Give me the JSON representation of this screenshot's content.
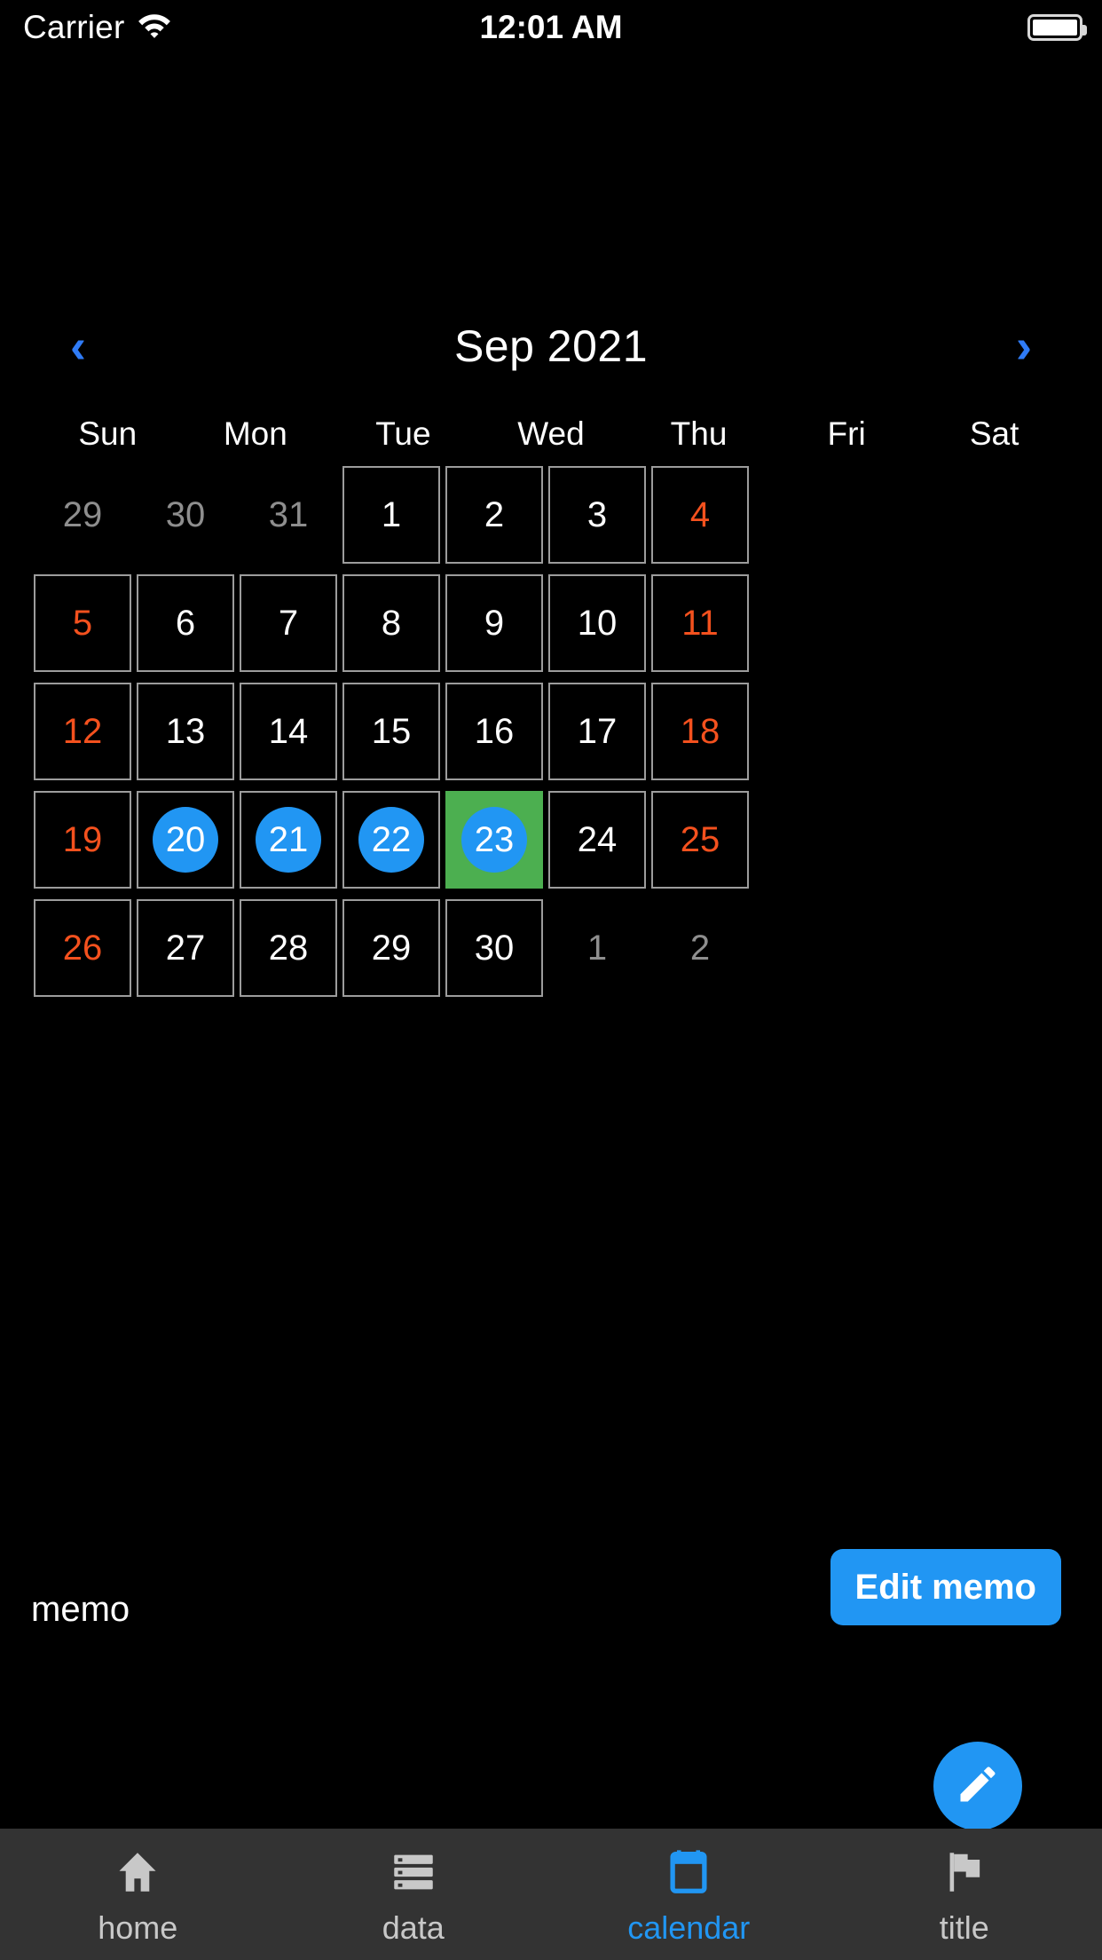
{
  "status_bar": {
    "carrier": "Carrier",
    "wifi_icon": "wifi-icon",
    "time": "12:01 AM",
    "battery_icon": "battery-full-icon"
  },
  "calendar": {
    "month_title": "Sep 2021",
    "prev_label": "‹",
    "next_label": "›",
    "weekdays": [
      "Sun",
      "Mon",
      "Tue",
      "Wed",
      "Thu",
      "Fri",
      "Sat"
    ],
    "weeks": [
      [
        {
          "day": "29",
          "in_month": false,
          "marked": false,
          "today": false
        },
        {
          "day": "30",
          "in_month": false,
          "marked": false,
          "today": false
        },
        {
          "day": "31",
          "in_month": false,
          "marked": false,
          "today": false
        },
        {
          "day": "1",
          "in_month": true,
          "marked": false,
          "today": false
        },
        {
          "day": "2",
          "in_month": true,
          "marked": false,
          "today": false
        },
        {
          "day": "3",
          "in_month": true,
          "marked": false,
          "today": false
        },
        {
          "day": "4",
          "in_month": true,
          "marked": false,
          "today": false
        }
      ],
      [
        {
          "day": "5",
          "in_month": true,
          "marked": false,
          "today": false
        },
        {
          "day": "6",
          "in_month": true,
          "marked": false,
          "today": false
        },
        {
          "day": "7",
          "in_month": true,
          "marked": false,
          "today": false
        },
        {
          "day": "8",
          "in_month": true,
          "marked": false,
          "today": false
        },
        {
          "day": "9",
          "in_month": true,
          "marked": false,
          "today": false
        },
        {
          "day": "10",
          "in_month": true,
          "marked": false,
          "today": false
        },
        {
          "day": "11",
          "in_month": true,
          "marked": false,
          "today": false
        }
      ],
      [
        {
          "day": "12",
          "in_month": true,
          "marked": false,
          "today": false
        },
        {
          "day": "13",
          "in_month": true,
          "marked": false,
          "today": false
        },
        {
          "day": "14",
          "in_month": true,
          "marked": false,
          "today": false
        },
        {
          "day": "15",
          "in_month": true,
          "marked": false,
          "today": false
        },
        {
          "day": "16",
          "in_month": true,
          "marked": false,
          "today": false
        },
        {
          "day": "17",
          "in_month": true,
          "marked": false,
          "today": false
        },
        {
          "day": "18",
          "in_month": true,
          "marked": false,
          "today": false
        }
      ],
      [
        {
          "day": "19",
          "in_month": true,
          "marked": false,
          "today": false
        },
        {
          "day": "20",
          "in_month": true,
          "marked": true,
          "today": false
        },
        {
          "day": "21",
          "in_month": true,
          "marked": true,
          "today": false
        },
        {
          "day": "22",
          "in_month": true,
          "marked": true,
          "today": false
        },
        {
          "day": "23",
          "in_month": true,
          "marked": true,
          "today": true
        },
        {
          "day": "24",
          "in_month": true,
          "marked": false,
          "today": false
        },
        {
          "day": "25",
          "in_month": true,
          "marked": false,
          "today": false
        }
      ],
      [
        {
          "day": "26",
          "in_month": true,
          "marked": false,
          "today": false
        },
        {
          "day": "27",
          "in_month": true,
          "marked": false,
          "today": false
        },
        {
          "day": "28",
          "in_month": true,
          "marked": false,
          "today": false
        },
        {
          "day": "29",
          "in_month": true,
          "marked": false,
          "today": false
        },
        {
          "day": "30",
          "in_month": true,
          "marked": false,
          "today": false
        },
        {
          "day": "1",
          "in_month": false,
          "marked": false,
          "today": false
        },
        {
          "day": "2",
          "in_month": false,
          "marked": false,
          "today": false
        }
      ]
    ]
  },
  "memo": {
    "label": "memo",
    "edit_button": "Edit memo"
  },
  "fab": {
    "icon": "edit-pencil-icon"
  },
  "tabbar": {
    "items": [
      {
        "label": "home",
        "icon": "home-icon",
        "active": false
      },
      {
        "label": "data",
        "icon": "data-storage-icon",
        "active": false
      },
      {
        "label": "calendar",
        "icon": "calendar-icon",
        "active": true
      },
      {
        "label": "title",
        "icon": "flag-icon",
        "active": false
      }
    ]
  },
  "colors": {
    "background": "#000000",
    "accent_blue": "#2196f3",
    "today_green": "#4CAF50",
    "weekend_red": "#f4511e",
    "cell_border": "#9c9c9c",
    "out_month_text": "#8e8e8e",
    "tabbar_bg": "#333333"
  }
}
